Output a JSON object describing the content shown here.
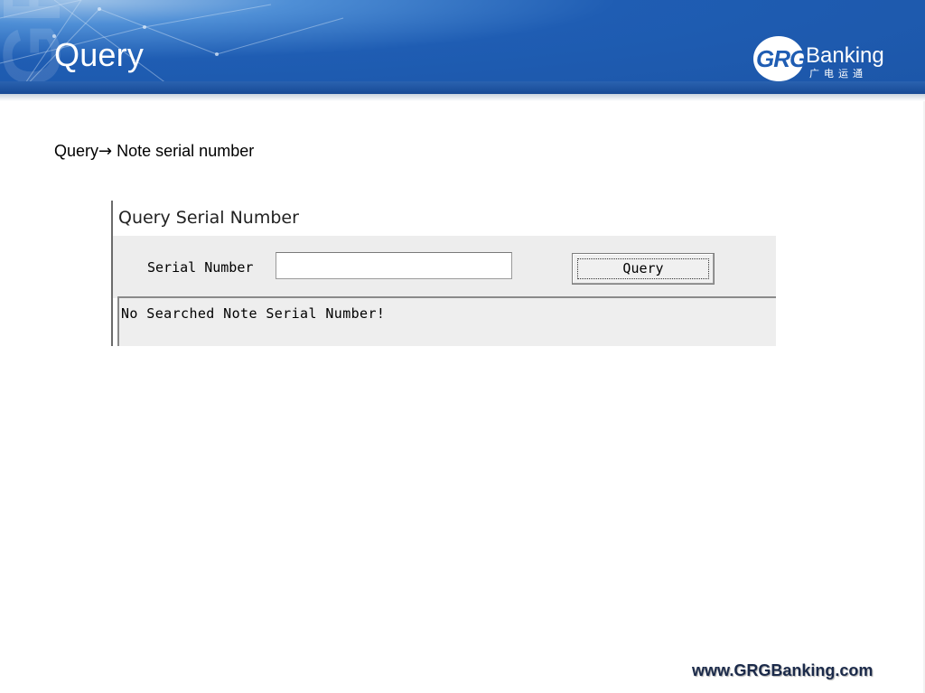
{
  "header": {
    "title": "Query",
    "logo_brand": "GRG",
    "logo_name": "Banking",
    "logo_subtitle": "广电运通"
  },
  "content": {
    "breadcrumb_from": "Query",
    "breadcrumb_to": "Note serial number"
  },
  "dialog": {
    "title": "Query Serial Number",
    "serial_label": "Serial Number",
    "serial_value": "",
    "query_button": "Query",
    "result_message": "No Searched Note Serial Number!"
  },
  "footer": {
    "url": "www.GRGBanking.com"
  },
  "colors": {
    "header_blue": "#1f5db3",
    "dialog_gray": "#ededed"
  },
  "icons": {
    "breadcrumb_separator": "arrow-right-icon"
  }
}
